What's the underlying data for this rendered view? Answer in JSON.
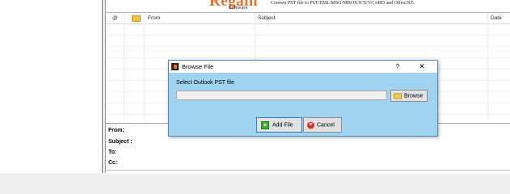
{
  "banner": {
    "logo_text": "Regain",
    "logo_sub": "Software",
    "tagline": "Convert PST file to PST/EML/MSG/MBOX/ICS/VCARD and Office365"
  },
  "grid": {
    "attach_glyph": "@",
    "icon_column": "envelope-icon",
    "col_from": "From",
    "col_subject": "Subject",
    "col_date": "Date"
  },
  "preview": {
    "from_label": "From:",
    "subject_label": "Subject :",
    "to_label": "To:",
    "cc_label": "Cc:"
  },
  "dialog": {
    "title": "Browse File",
    "help_glyph": "?",
    "close_glyph": "✕",
    "pst_label": "Select Outlook PST file",
    "path_value": "",
    "browse_label": "Browse",
    "add_file_label": "Add File",
    "cancel_label": "Cancel",
    "colors": {
      "background": "#9fd3ef",
      "border": "#4f8fbf",
      "logo": "#e8702a"
    }
  }
}
